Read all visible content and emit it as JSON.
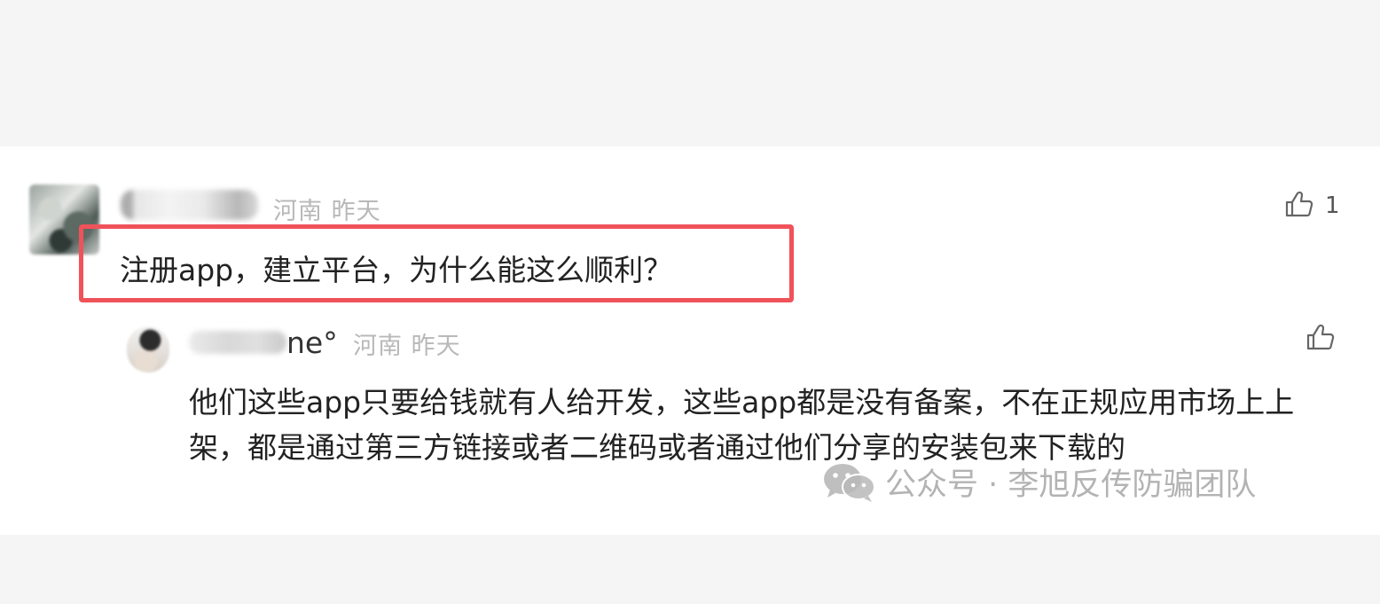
{
  "comment": {
    "username_visible": "",
    "location": "河南",
    "time": "昨天",
    "likes": "1",
    "text": "注册app，建立平台，为什么能这么顺利？"
  },
  "reply": {
    "username_visible": "ne°",
    "location": "河南",
    "time": "昨天",
    "text": "他们这些app只要给钱就有人给开发，这些app都是没有备案，不在正规应用市场上上架，都是通过第三方链接或者二维码或者通过他们分享的安装包来下载的"
  },
  "watermark": {
    "text": "公众号 · 李旭反传防骗团队",
    "icon": "wechat-icon"
  },
  "colors": {
    "highlight": "#f0525a",
    "meta": "#b8b8b8",
    "background": "#f5f5f5"
  }
}
